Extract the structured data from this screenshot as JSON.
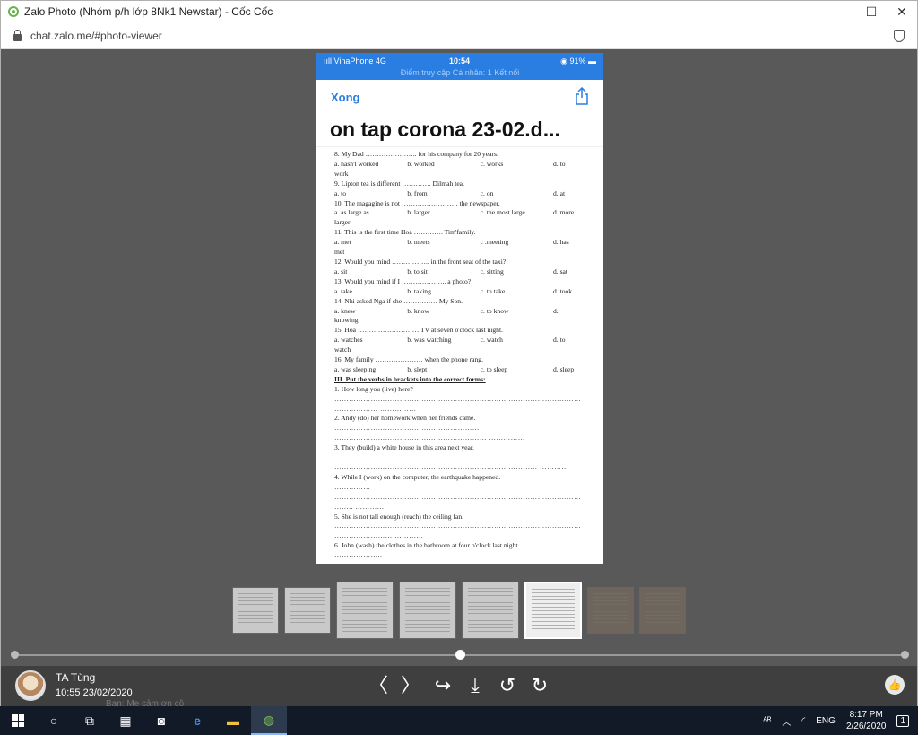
{
  "window": {
    "title": "Zalo Photo (Nhóm p/h lớp 8Nk1 Newstar) - Cốc Cốc",
    "minimize": "—",
    "maximize": "☐",
    "close": "✕"
  },
  "address": {
    "url": "chat.zalo.me/#photo-viewer"
  },
  "phone": {
    "carrier": "ııll VinaPhone  4G",
    "time": "10:54",
    "battery": "◉ 91% ▬",
    "access_note": "Điểm truy cập Cá nhân: 1 Kết nối",
    "done_label": "Xong",
    "doc_title": "on tap corona 23-02.d..."
  },
  "document": {
    "q8": "8. My Dad ………………….. for his company for 20 years.",
    "q8_opts": [
      "a. hasn't worked",
      "b. worked",
      "c. works",
      "d. to"
    ],
    "q8_tail": "work",
    "q9": "9. Lipton tea is different …………. Dilmah tea.",
    "q9_opts": [
      "a. to",
      "b. from",
      "c. on",
      "d. at"
    ],
    "q10": "10. The magagine is not ……………………. the newspaper.",
    "q10_opts": [
      "a. as large as",
      "b. larger",
      "c. the most large",
      "d. more"
    ],
    "q10_tail": "larger",
    "q11": "11. This is the first time Hoa …………. Tim'family.",
    "q11_opts": [
      "a. met",
      "b. meets",
      "c .meeting",
      "d. has"
    ],
    "q11_tail": "met",
    "q12": "12. Would you mind …………….. in the front seat of the taxi?",
    "q12_opts": [
      "a. sit",
      "b. to sit",
      "c. sitting",
      "d. sat"
    ],
    "q13": "13. Would you mind if I ……………….. a photo?",
    "q13_opts": [
      "a. take",
      "b. taking",
      "c. to take",
      "d. took"
    ],
    "q14": "14. Nhi asked Nga if she …………… My Son.",
    "q14_opts": [
      "a. knew",
      "b. know",
      "c. to know",
      "d."
    ],
    "q14_tail": "knowing",
    "q15": "15. Hoa ……………………… TV at seven o'clock last night.",
    "q15_opts": [
      "a. watches",
      "b. was watching",
      "c. watch",
      "d. to"
    ],
    "q15_tail": "watch",
    "q16": "16. My family ………………… when the phone rang.",
    "q16_opts": [
      "a. was sleeping",
      "b. slept",
      "c. to sleep",
      "d. sleep"
    ],
    "section3": "III. Put the verbs in brackets into the correct forms:",
    "e1": "1. How long you (live) here?",
    "e1_dots": "…………………………………………………………………………………………",
    "e1_dots2": "……………… ……………",
    "e2": "2. Andy (do) her homework when her friends came.",
    "e2_dots": "……………………………………………………",
    "e2_dots2": "……………………………………………………… ……………",
    "e3": "3. They (build) a white house in this area next year.",
    "e3_dots": "……………………………………………",
    "e3_dots2": "………………………………………………………………………… …………",
    "e4": "4. While I (work) on the computer, the earthquake happened.",
    "e4_dots": "……………",
    "e4_dots2": "…………………………………………………………………………………………",
    "e4_dots3": "…….. …………",
    "e5": "5. She is not tall enough (reach) the ceiling fan.",
    "e5_dots": "…………………………………………………………………………………………",
    "e5_dots2": "…………………… …………",
    "e6": "6. John (wash) the clothes in the bathroom at four o'clock last night.",
    "e6_dots": "……………….."
  },
  "slider": {
    "position_fraction": 0.5
  },
  "bottom": {
    "sender": "TA Tùng",
    "sent_time": "10:55 23/02/2020",
    "prev": "〈",
    "next": "〉",
    "forward": "↪",
    "download": "⤓",
    "rotate_left": "↺",
    "rotate_right": "↻",
    "like": "👍"
  },
  "behind_text": "Bạn: Mẹ cảm ơn cô",
  "taskbar": {
    "lang": "ENG",
    "time": "8:17 PM",
    "date": "2/26/2020",
    "notif": "1"
  }
}
